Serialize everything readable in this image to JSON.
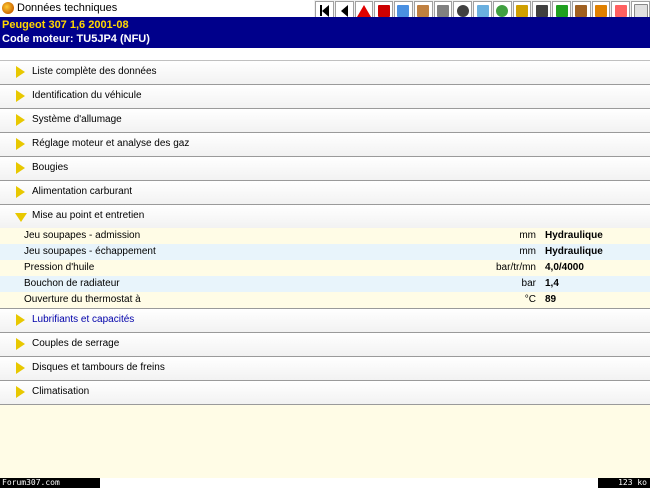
{
  "window": {
    "title": "Données techniques",
    "icon": "app-icon"
  },
  "vehicle": {
    "line1": "Peugeot  307  1,6  2001-08",
    "line2": "Code moteur: TU5JP4 (NFU)"
  },
  "toolbar": [
    {
      "name": "first-page-icon",
      "color": "#000000"
    },
    {
      "name": "previous-icon",
      "color": "#000000"
    },
    {
      "name": "warning-icon",
      "color": "#e00000"
    },
    {
      "name": "book-icon",
      "color": "#cc0000"
    },
    {
      "name": "landscape-icon",
      "color": "#4a90e2"
    },
    {
      "name": "engine-icon",
      "color": "#c08040"
    },
    {
      "name": "tools-icon",
      "color": "#808080"
    },
    {
      "name": "wheel-icon",
      "color": "#404040"
    },
    {
      "name": "cloud-icon",
      "color": "#6ab0e0"
    },
    {
      "name": "rotate-icon",
      "color": "#40a040"
    },
    {
      "name": "label-icon",
      "color": "#d0a000"
    },
    {
      "name": "battery-icon",
      "color": "#404040"
    },
    {
      "name": "lock-icon",
      "color": "#20a020"
    },
    {
      "name": "cabinet-icon",
      "color": "#a06020"
    },
    {
      "name": "oil-can-icon",
      "color": "#e08000"
    },
    {
      "name": "car-icon",
      "color": "#ff6060"
    },
    {
      "name": "window-icon",
      "color": "#e0e0e0"
    }
  ],
  "sections_before": [
    {
      "id": "liste",
      "label": "Liste complète des données"
    },
    {
      "id": "identification",
      "label": "Identification du véhicule"
    },
    {
      "id": "allumage",
      "label": "Système d'allumage"
    },
    {
      "id": "reglage",
      "label": "Réglage moteur et analyse des gaz"
    },
    {
      "id": "bougies",
      "label": "Bougies"
    },
    {
      "id": "alimentation",
      "label": "Alimentation carburant"
    }
  ],
  "expanded_section": {
    "label": "Mise au point et entretien",
    "rows": [
      {
        "label": "Jeu soupapes - admission",
        "unit": "mm",
        "value": "Hydraulique"
      },
      {
        "label": "Jeu soupapes - échappement",
        "unit": "mm",
        "value": "Hydraulique"
      },
      {
        "label": "Pression d'huile",
        "unit": "bar/tr/mn",
        "value": "4,0/4000"
      },
      {
        "label": "Bouchon de radiateur",
        "unit": "bar",
        "value": "1,4"
      },
      {
        "label": "Ouverture du thermostat à",
        "unit": "°C",
        "value": "89"
      }
    ]
  },
  "sections_after": [
    {
      "id": "lubrifiants",
      "label": "Lubrifiants et capacités",
      "highlight": true
    },
    {
      "id": "couples",
      "label": "Couples de serrage"
    },
    {
      "id": "disques",
      "label": "Disques et tambours de freins"
    },
    {
      "id": "climatisation",
      "label": "Climatisation"
    }
  ],
  "statusbar": {
    "left": "Forum307.com",
    "right": "123 ko"
  },
  "colors": {
    "header_bg": "#00008b",
    "header_line1": "#ffd700",
    "content_bg": "#fffce6",
    "row_alt": "#e8f4fb",
    "arrow": "#e8c800"
  }
}
